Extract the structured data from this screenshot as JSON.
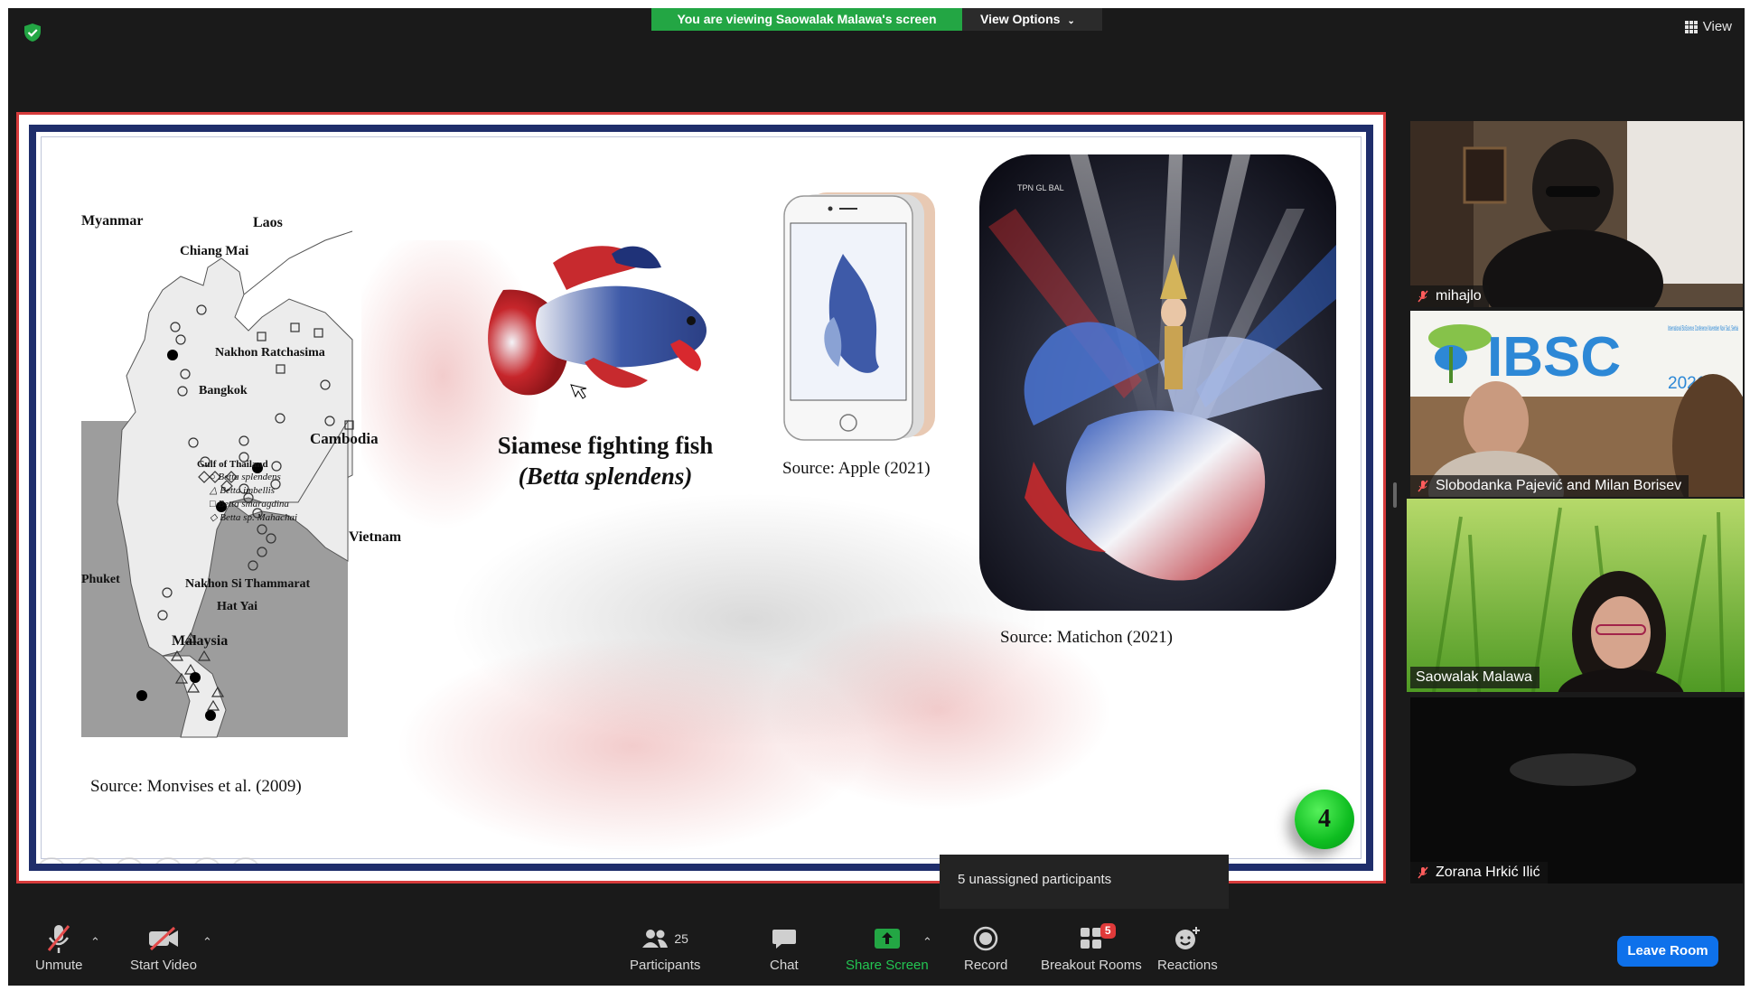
{
  "banner": {
    "viewing_text": "You are viewing Saowalak Malawa's screen",
    "view_options": "View Options",
    "view_label": "View"
  },
  "slide": {
    "map": {
      "labels": [
        "Myanmar",
        "Laos",
        "Chiang Mai",
        "Nakhon Ratchasima",
        "Bangkok",
        "Cambodia",
        "Gulf of Thailand",
        "Vietnam",
        "Phuket",
        "Nakhon Si Thammarat",
        "Hat Yai",
        "Malaysia"
      ],
      "legend": [
        "Betta splendens",
        "Betta imbellis",
        "Betta smaragdina",
        "Betta sp. Mahachai"
      ]
    },
    "map_source": "Source: Monvises et al. (2009)",
    "fish_title_line1": "Siamese fighting fish",
    "fish_title_line2": "(Betta splendens)",
    "apple_source": "Source: Apple (2021)",
    "gala_source": "Source: Matichon (2021)",
    "gala_logo": "TPN GL BAL",
    "page_number": "4"
  },
  "popup": {
    "unassigned_text": "5 unassigned participants"
  },
  "participants": [
    {
      "name": "mihajlo",
      "muted": true
    },
    {
      "name": "Slobodanka Pajević and Milan Borisev",
      "muted": true,
      "banner": "IBSC",
      "banner_sub": "International BioScience Conference November Novi Sad, Serbia",
      "banner_year": "2021"
    },
    {
      "name": "Saowalak Malawa",
      "muted": false,
      "active": true
    },
    {
      "name": "Zorana Hrkić Ilić",
      "muted": true
    }
  ],
  "toolbar": {
    "unmute": "Unmute",
    "start_video": "Start Video",
    "participants": "Participants",
    "participants_count": "25",
    "chat": "Chat",
    "share_screen": "Share Screen",
    "record": "Record",
    "breakout_rooms": "Breakout Rooms",
    "breakout_badge": "5",
    "reactions": "Reactions",
    "leave_room": "Leave Room"
  },
  "colors": {
    "share_green": "#23a644",
    "leave_blue": "#0e71eb",
    "active_speaker": "#e3e33a",
    "slide_border": "#1f2e6b",
    "share_frame": "#d63b3b"
  }
}
